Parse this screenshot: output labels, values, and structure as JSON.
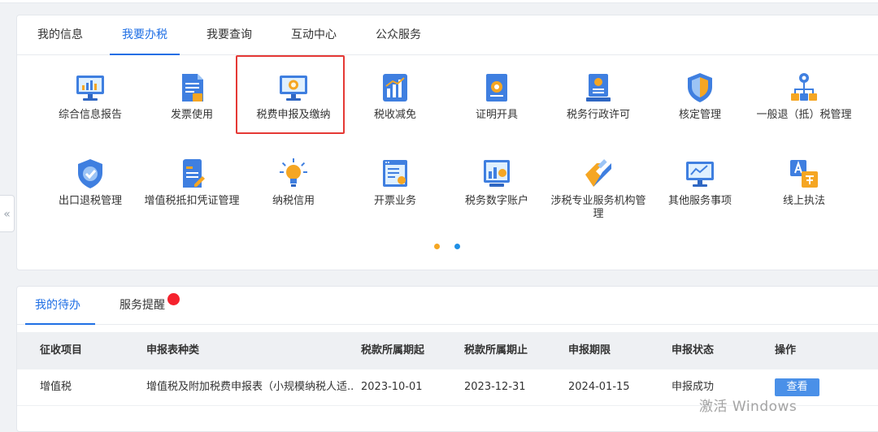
{
  "top_tabs": [
    {
      "label": "我的信息",
      "active": false
    },
    {
      "label": "我要办税",
      "active": true
    },
    {
      "label": "我要查询",
      "active": false
    },
    {
      "label": "互动中心",
      "active": false
    },
    {
      "label": "公众服务",
      "active": false
    }
  ],
  "services": [
    {
      "label": "综合信息报告",
      "icon": "monitor-chart-icon"
    },
    {
      "label": "发票使用",
      "icon": "invoice-icon"
    },
    {
      "label": "税费申报及缴纳",
      "icon": "monitor-coin-icon",
      "highlighted": true
    },
    {
      "label": "税收减免",
      "icon": "bar-chart-icon"
    },
    {
      "label": "证明开具",
      "icon": "certificate-icon"
    },
    {
      "label": "税务行政许可",
      "icon": "license-icon"
    },
    {
      "label": "核定管理",
      "icon": "shield-icon"
    },
    {
      "label": "一般退（抵）税管理",
      "icon": "hierarchy-icon"
    },
    {
      "label": "出口退税管理",
      "icon": "shield-check-icon"
    },
    {
      "label": "增值税抵扣凭证管理",
      "icon": "document-edit-icon"
    },
    {
      "label": "纳税信用",
      "icon": "lightbulb-icon"
    },
    {
      "label": "开票业务",
      "icon": "invoice-window-icon"
    },
    {
      "label": "税务数字账户",
      "icon": "account-chart-icon"
    },
    {
      "label": "涉税专业服务机构管理",
      "icon": "tag-icon"
    },
    {
      "label": "其他服务事项",
      "icon": "monitor-line-icon"
    },
    {
      "label": "线上执法",
      "icon": "translate-icon"
    }
  ],
  "pager": {
    "dot_colors": [
      "#f5a623",
      "#1f8fe5"
    ]
  },
  "collapse_handle": "«",
  "bottom_tabs": [
    {
      "label": "我的待办",
      "active": true
    },
    {
      "label": "服务提醒",
      "active": false,
      "badge": true
    }
  ],
  "table": {
    "headers": [
      "征收项目",
      "申报表种类",
      "税款所属期起",
      "税款所属期止",
      "申报期限",
      "申报状态",
      "操作"
    ],
    "rows": [
      [
        "增值税",
        "增值税及附加税费申报表（小规模纳税人适...",
        "2023-10-01",
        "2023-12-31",
        "2024-01-15",
        "申报成功",
        "查看"
      ]
    ]
  },
  "watermark": "激活 Windows",
  "colors": {
    "accent": "#1f6fe5",
    "highlight": "#e53935",
    "badge": "#f5222d"
  }
}
